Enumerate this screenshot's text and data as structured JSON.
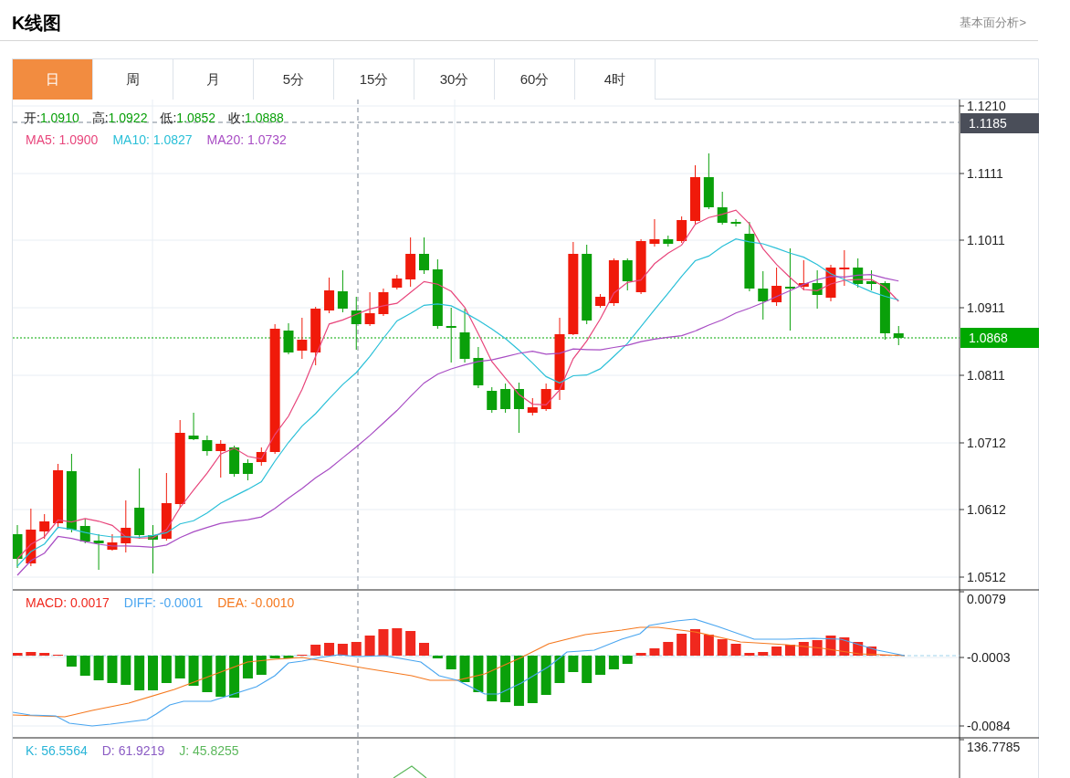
{
  "header": {
    "title": "K线图",
    "link": "基本面分析>"
  },
  "tabs": [
    {
      "label": "日",
      "selected": true
    },
    {
      "label": "周",
      "selected": false
    },
    {
      "label": "月",
      "selected": false
    },
    {
      "label": "5分",
      "selected": false
    },
    {
      "label": "15分",
      "selected": false
    },
    {
      "label": "30分",
      "selected": false
    },
    {
      "label": "60分",
      "selected": false
    },
    {
      "label": "4时",
      "selected": false
    }
  ],
  "price_legend": [
    {
      "label": "开:",
      "value": "1.0910"
    },
    {
      "label": "高:",
      "value": "1.0922"
    },
    {
      "label": "低:",
      "value": "1.0852"
    },
    {
      "label": "收:",
      "value": "1.0888"
    }
  ],
  "ma_legend": [
    {
      "label": "MA5:",
      "value": "1.0900",
      "color": "#e8467c"
    },
    {
      "label": "MA10:",
      "value": "1.0827",
      "color": "#2bc0d8"
    },
    {
      "label": "MA20:",
      "value": "1.0732",
      "color": "#a84dc4"
    }
  ],
  "price_axis": {
    "ticks": [
      "1.1210",
      "1.1111",
      "1.1011",
      "1.0911",
      "1.0811",
      "1.0712",
      "1.0612",
      "1.0512"
    ],
    "crosshair_tag": "1.1185",
    "last_price_tag": "1.0868"
  },
  "macd_legend": [
    {
      "label": "MACD:",
      "value": "0.0017",
      "color": "#f0281e"
    },
    {
      "label": "DIFF:",
      "value": "-0.0001",
      "color": "#4aa6f0"
    },
    {
      "label": "DEA:",
      "value": "-0.0010",
      "color": "#f5781e"
    }
  ],
  "macd_axis": {
    "ticks": [
      "0.0079",
      "-0.0003",
      "-0.0084"
    ]
  },
  "kdj_legend": [
    {
      "label": "K:",
      "value": "56.5564",
      "color": "#2bb5d8"
    },
    {
      "label": "D:",
      "value": "61.9219",
      "color": "#8b5cc4"
    },
    {
      "label": "J:",
      "value": "45.8255",
      "color": "#5cb85c"
    }
  ],
  "kdj_axis": {
    "ticks": [
      "136.7785"
    ]
  }
}
